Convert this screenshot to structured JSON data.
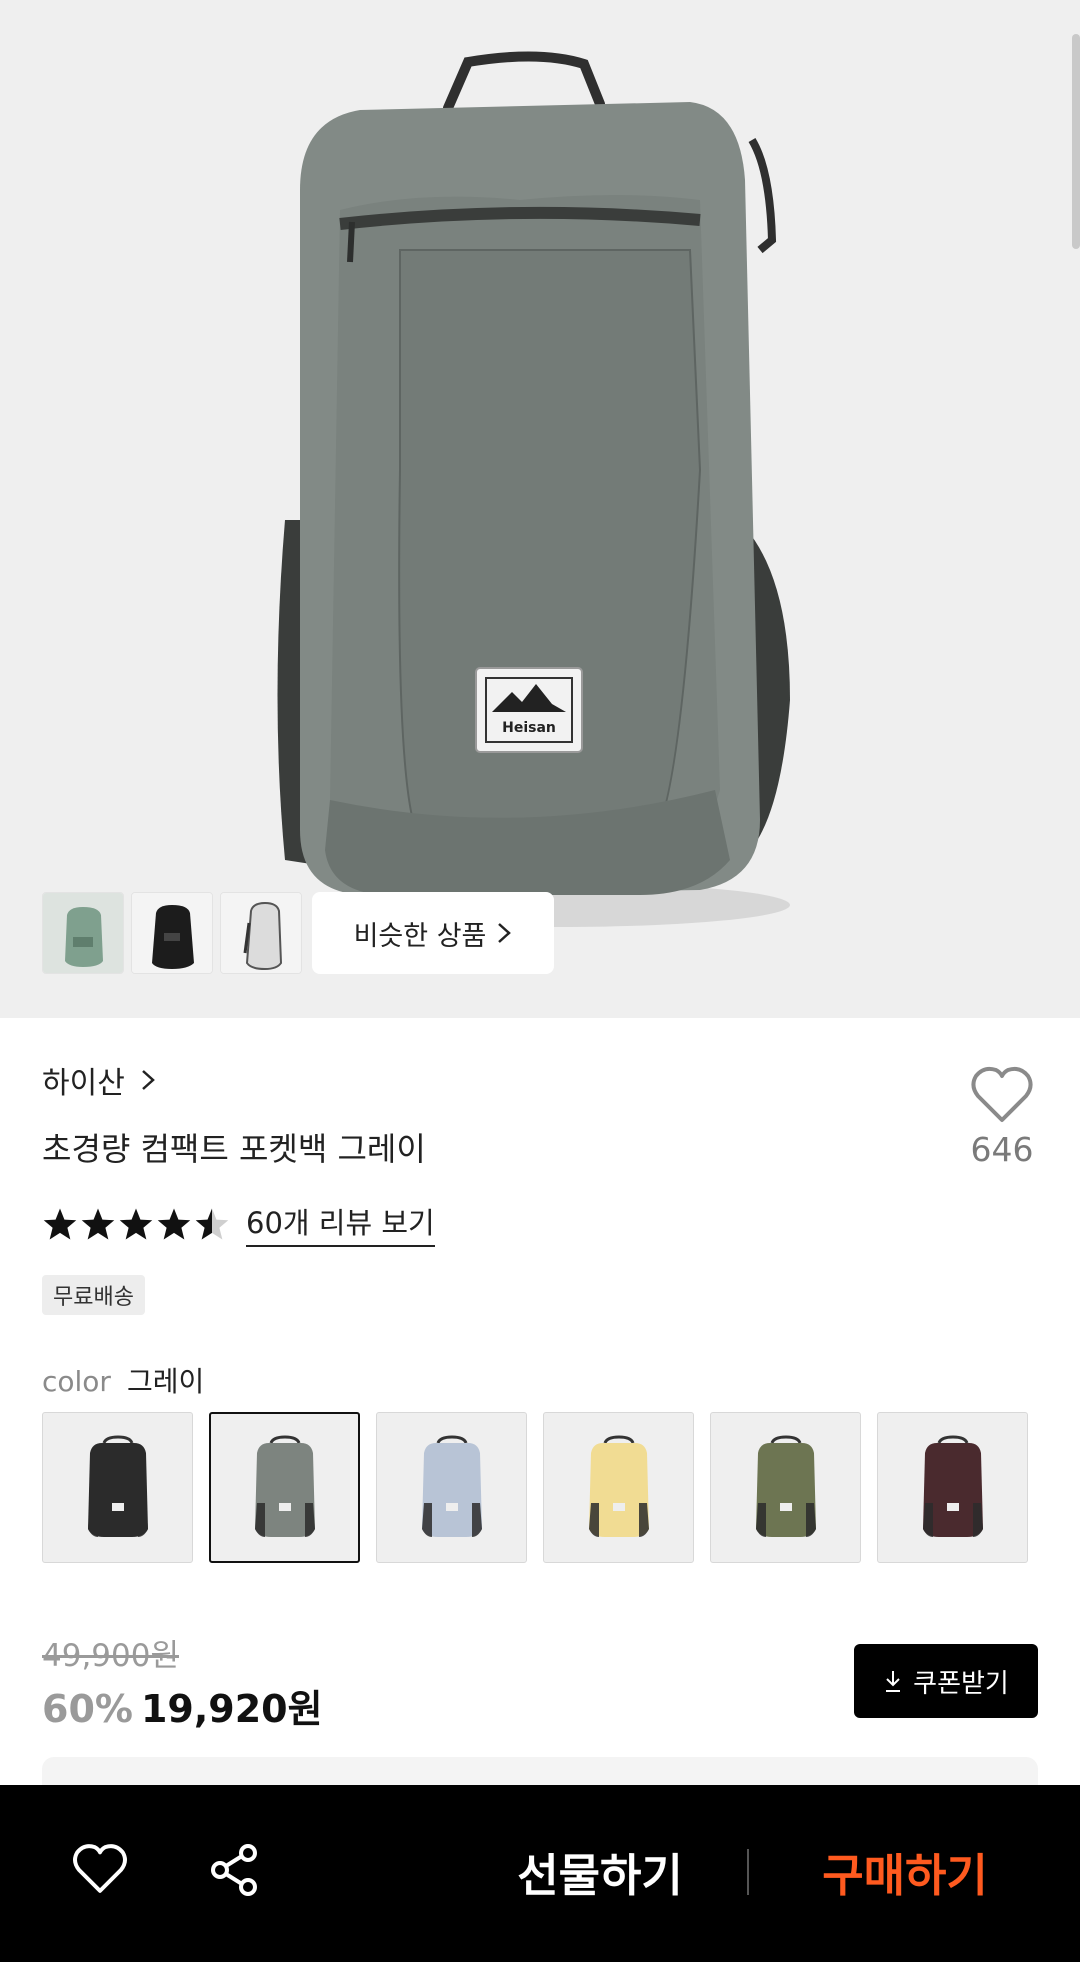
{
  "hero": {
    "similar_label": "비슷한 상품",
    "patch_text": "Heisan",
    "thumbnails": [
      "green-backpack",
      "black-backpack",
      "white-backpack"
    ]
  },
  "product": {
    "brand": "하이산",
    "title": "초경량 컴팩트 포켓백 그레이",
    "like_count": "646",
    "rating": 4.5,
    "review_link": "60개 리뷰 보기",
    "shipping_badge": "무료배송"
  },
  "color_option": {
    "label": "color",
    "selected": "그레이",
    "swatches": [
      {
        "name": "black",
        "hex": "#2b2b2b"
      },
      {
        "name": "gray",
        "hex": "#7d847f"
      },
      {
        "name": "light-blue",
        "hex": "#b8c4d6"
      },
      {
        "name": "yellow",
        "hex": "#f1dc93"
      },
      {
        "name": "olive",
        "hex": "#6d7552"
      },
      {
        "name": "burgundy",
        "hex": "#4a2a2e"
      }
    ],
    "selected_index": 1
  },
  "price": {
    "original": "49,900원",
    "discount": "60%",
    "sale": "19,920원",
    "coupon_label": "쿠폰받기"
  },
  "bottom_bar": {
    "gift_label": "선물하기",
    "buy_label": "구매하기"
  },
  "colors": {
    "accent": "#ff5a1f",
    "bar": "#000000"
  }
}
